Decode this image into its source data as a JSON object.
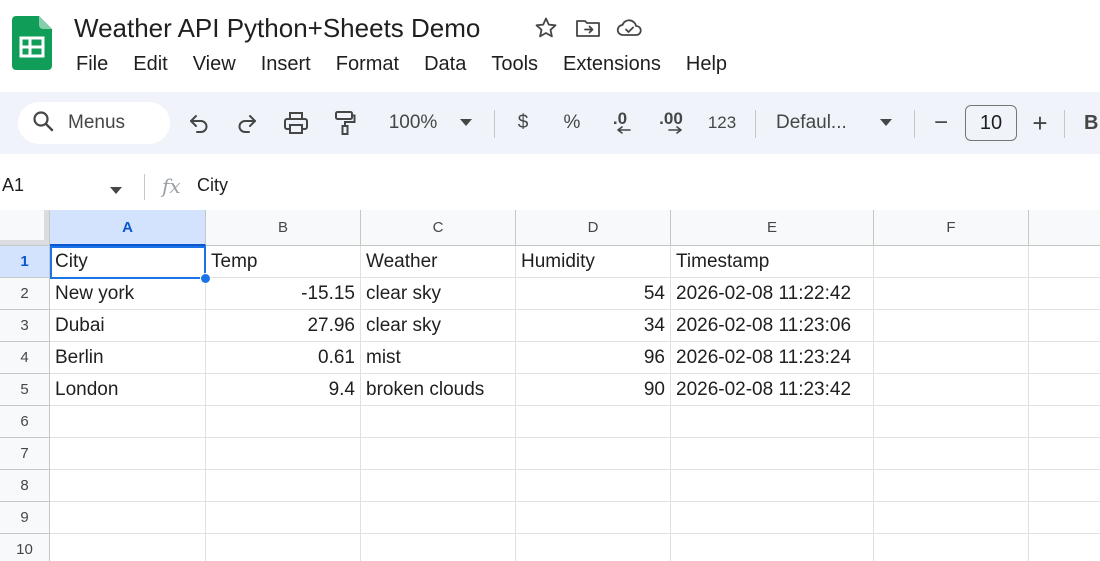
{
  "document": {
    "title": "Weather API Python+Sheets Demo"
  },
  "menu": [
    "File",
    "Edit",
    "View",
    "Insert",
    "Format",
    "Data",
    "Tools",
    "Extensions",
    "Help"
  ],
  "toolbar": {
    "search_label": "Menus",
    "zoom": "100%",
    "currency": "$",
    "percent": "%",
    "decrease_decimal": ".0",
    "increase_decimal": ".00",
    "number_format": "123",
    "font": "Defaul...",
    "font_size": "10",
    "minus": "−",
    "plus": "+",
    "bold": "B"
  },
  "formula_bar": {
    "cell_ref": "A1",
    "fx": "fx",
    "value": "City"
  },
  "grid": {
    "columns": [
      "A",
      "B",
      "C",
      "D",
      "E",
      "F"
    ],
    "rows": [
      "1",
      "2",
      "3",
      "4",
      "5",
      "6",
      "7",
      "8",
      "9",
      "10"
    ],
    "headers": [
      "City",
      "Temp",
      "Weather",
      "Humidity",
      "Timestamp"
    ],
    "data": [
      [
        "New york",
        "-15.15",
        "clear sky",
        "54",
        "2026-02-08 11:22:42"
      ],
      [
        "Dubai",
        "27.96",
        "clear sky",
        "34",
        "2026-02-08 11:23:06"
      ],
      [
        "Berlin",
        "0.61",
        "mist",
        "96",
        "2026-02-08 11:23:24"
      ],
      [
        "London",
        "9.4",
        "broken clouds",
        "90",
        "2026-02-08 11:23:42"
      ]
    ],
    "selected_cell": "A1"
  },
  "colors": {
    "accent": "#1a73e8",
    "sheets_green": "#0f9d58",
    "toolbar_bg": "#f0f3f9"
  }
}
